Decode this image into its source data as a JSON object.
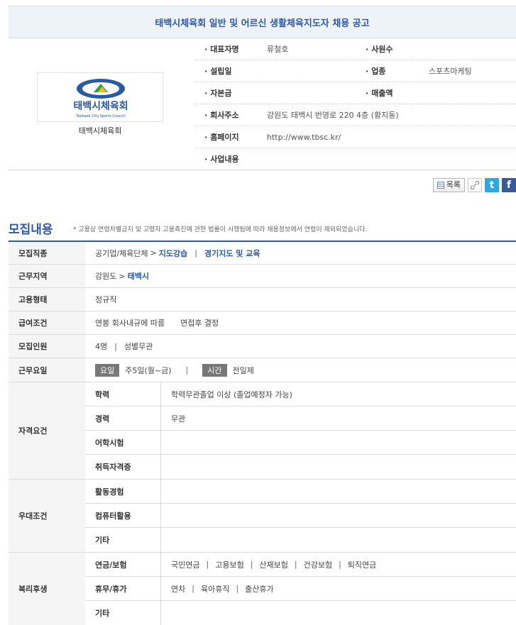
{
  "title": "태백시체육회 일반 및 어르신 생활체육지도자 채용 공고",
  "company": {
    "name": "태백시체육회",
    "logo": {
      "text": "태백시체육회",
      "sub": "Taebaek City Sports Council",
      "ring_text": "TAEBAEK SPORTS"
    },
    "rows": [
      {
        "l1": "대표자명",
        "v1": "류철호",
        "l2": "사원수",
        "v2": ""
      },
      {
        "l1": "설립일",
        "v1": "",
        "l2": "업종",
        "v2": "스포츠마케팅"
      },
      {
        "l1": "자본금",
        "v1": "",
        "l2": "매출액",
        "v2": ""
      },
      {
        "l1": "회사주소",
        "v1": "강원도 태백시 번영로 220 4층 (황지동)",
        "l2": "",
        "v2": ""
      },
      {
        "l1": "홈페이지",
        "v1": "http://www.tbsc.kr/",
        "l2": "",
        "v2": ""
      },
      {
        "l1": "사업내용",
        "v1": "",
        "l2": "",
        "v2": ""
      }
    ]
  },
  "toolbar": {
    "list_label": "목록",
    "link_icon": "link-icon",
    "twitter_label": "t",
    "facebook_label": "f"
  },
  "section": {
    "title": "모집내용",
    "note": "* 고용상 연령차별금지 및 고령자 고용촉진에 관한 법률이 시행됨에 따라 채용정보에서 연령이 제외되었습니다."
  },
  "details": {
    "job": {
      "label": "모집직종",
      "category": "공기업/체육단체",
      "arrow": ">",
      "item1": "지도강습",
      "sep": "|",
      "item2": "경기지도 및 교육"
    },
    "region": {
      "label": "근무지역",
      "province": "강원도",
      "arrow": ">",
      "city": "태백시"
    },
    "employment": {
      "label": "고용형태",
      "value": "정규직"
    },
    "salary": {
      "label": "급여조건",
      "value1": "연봉 회사내규에 따름",
      "value2": "면접후 결정"
    },
    "headcount": {
      "label": "모집인원",
      "value1": "4명",
      "sep": "|",
      "value2": "성별무관"
    },
    "workdays": {
      "label": "근무요일",
      "tag1": "요일",
      "value1": "주5일(월~금)",
      "sep": "|",
      "tag2": "시간",
      "value2": "전일제"
    },
    "qualifications": {
      "label": "자격요건",
      "rows": [
        {
          "k": "학력",
          "v": "학력무관졸업 이상 (졸업예정자 가능)"
        },
        {
          "k": "경력",
          "v": "무관"
        },
        {
          "k": "어학시험",
          "v": ""
        },
        {
          "k": "취득자격증",
          "v": ""
        }
      ]
    },
    "preferences": {
      "label": "우대조건",
      "rows": [
        {
          "k": "활동경험",
          "v": ""
        },
        {
          "k": "컴퓨터활용",
          "v": ""
        },
        {
          "k": "기타",
          "v": ""
        }
      ]
    },
    "welfare": {
      "label": "복리후생",
      "rows": [
        {
          "k": "연금/보험",
          "items": [
            "국민연금",
            "고용보험",
            "산재보험",
            "건강보험",
            "퇴직연금"
          ]
        },
        {
          "k": "휴무/휴가",
          "items": [
            "연차",
            "육아휴직",
            "출산휴가"
          ]
        },
        {
          "k": "기타",
          "items": []
        }
      ]
    }
  },
  "colors": {
    "accent": "#2e5aa7",
    "title_bg": "#eef3f9",
    "label_bg": "#f5f5f5",
    "twitter": "#2ea8e0",
    "facebook": "#3b5998"
  }
}
